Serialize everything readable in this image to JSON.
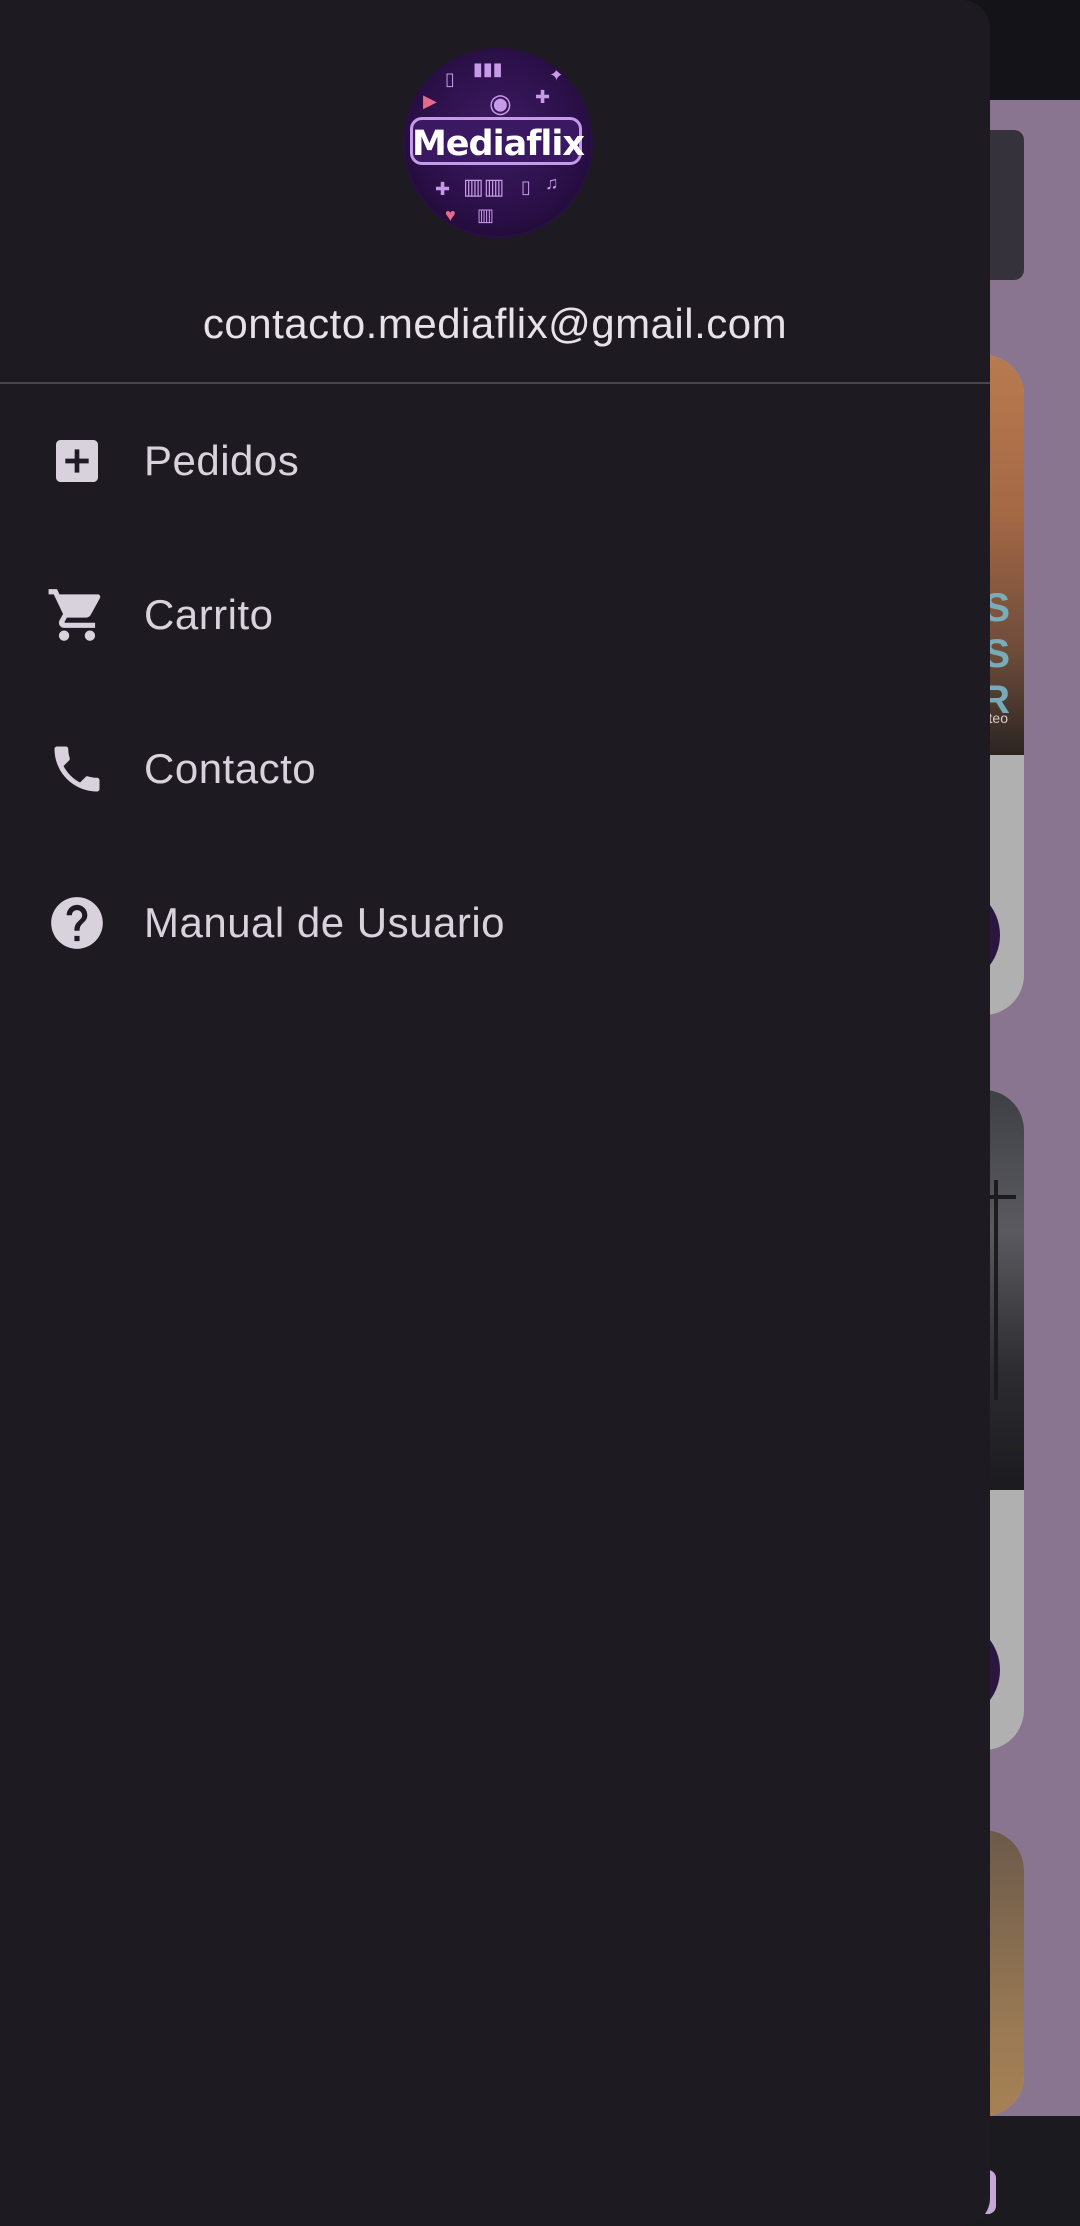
{
  "drawer": {
    "logo": {
      "text": "Mediaflix",
      "colors": {
        "background": "#2a0f47",
        "accent": "#c69ae6"
      }
    },
    "email": "contacto.mediaflix@gmail.com",
    "items": [
      {
        "label": "Pedidos",
        "icon": "add-box-icon"
      },
      {
        "label": "Carrito",
        "icon": "shopping-cart-icon"
      },
      {
        "label": "Contacto",
        "icon": "phone-icon"
      },
      {
        "label": "Manual de Usuario",
        "icon": "help-icon"
      }
    ]
  },
  "background": {
    "poster_1_text": "S\nS\nR",
    "poster_1_small": "teo"
  },
  "colors": {
    "drawer_bg": "#1d1b21",
    "scrim_content": "#8a7591",
    "text": "#d8d2dc",
    "divider": "#47454d"
  }
}
